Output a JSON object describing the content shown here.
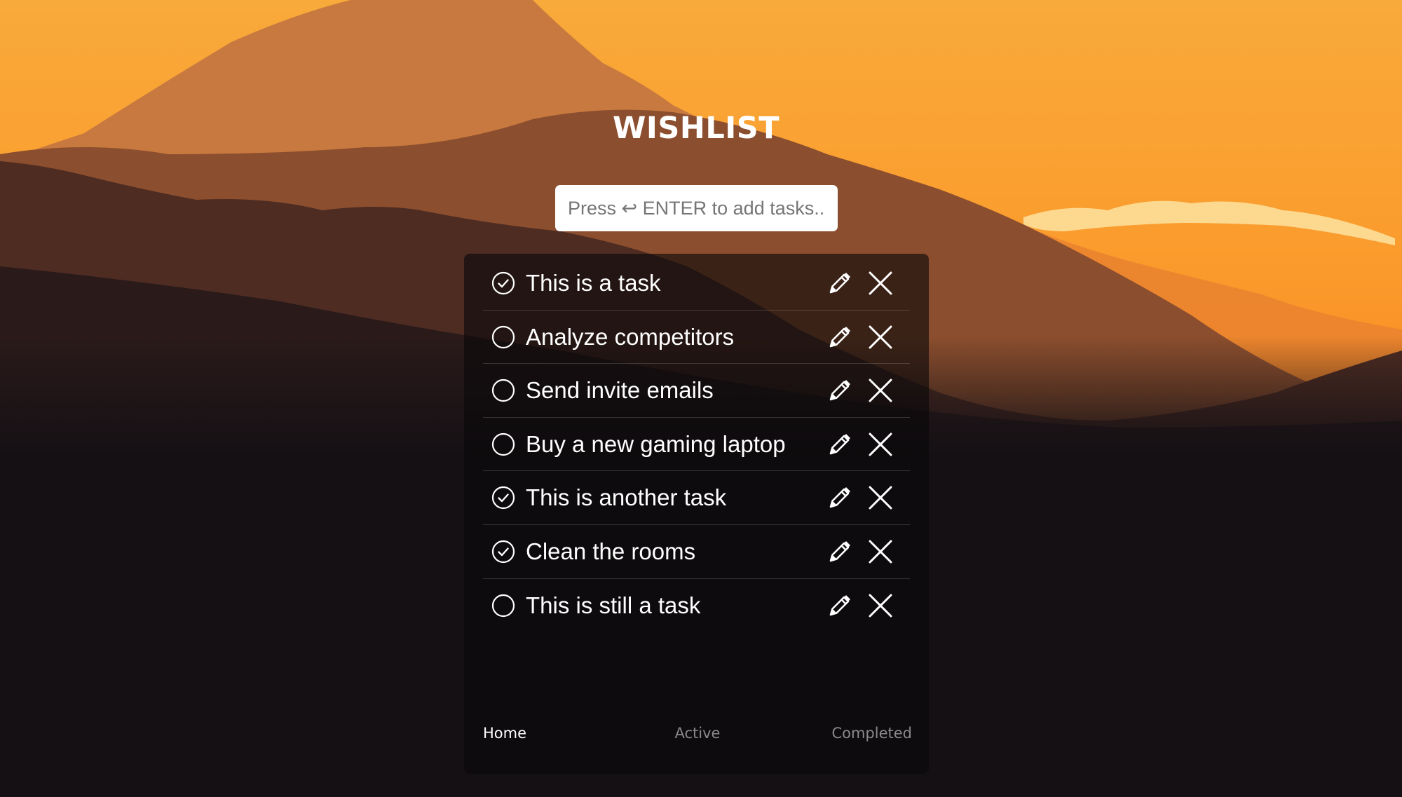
{
  "app": {
    "title": "WISHLIST"
  },
  "input": {
    "placeholder": "Press ↩ ENTER to add tasks...",
    "value": ""
  },
  "tasks": [
    {
      "label": "This is a task",
      "completed": true
    },
    {
      "label": "Analyze competitors",
      "completed": false
    },
    {
      "label": "Send invite emails",
      "completed": false
    },
    {
      "label": "Buy a new gaming laptop",
      "completed": false
    },
    {
      "label": "This is another task",
      "completed": true
    },
    {
      "label": "Clean the rooms",
      "completed": true
    },
    {
      "label": "This is still a task",
      "completed": false
    }
  ],
  "nav": {
    "home": "Home",
    "active": "Active",
    "completed": "Completed",
    "selected": "home"
  },
  "icons": {
    "checkbox_done": "check-circle-icon",
    "checkbox_open": "empty-circle-icon",
    "edit": "pencil-icon",
    "delete": "close-icon"
  },
  "colors": {
    "sky_top": "#f5a033",
    "sky_bottom": "#fb8a24",
    "panel": "#0a080a",
    "text": "#ffffff",
    "muted_nav": "#8a8a8a"
  }
}
